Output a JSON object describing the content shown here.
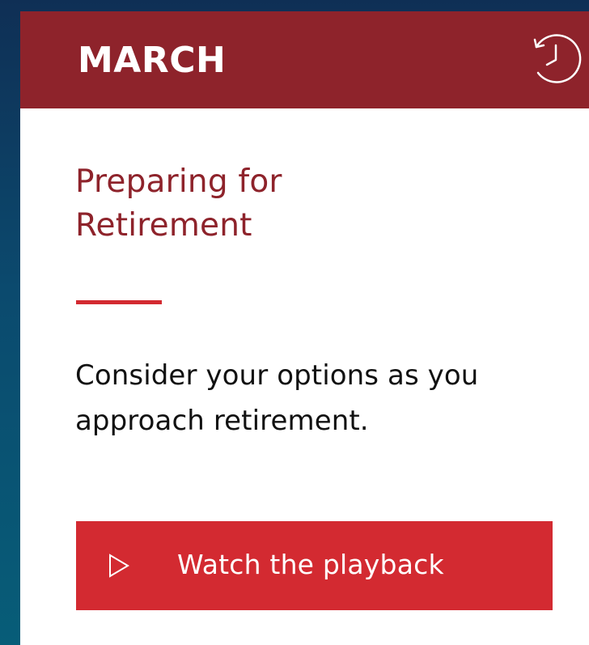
{
  "card": {
    "month": "MARCH",
    "title": "Preparing for Retirement",
    "description": "Consider your options as you approach retirement.",
    "cta_label": "Watch the playback"
  },
  "icons": {
    "header_icon": "history-icon",
    "cta_icon": "play-icon"
  },
  "colors": {
    "header_red": "#8e232b",
    "title_red": "#8e232b",
    "accent_red": "#d32a31",
    "page_blue": "#0b4a6e"
  }
}
